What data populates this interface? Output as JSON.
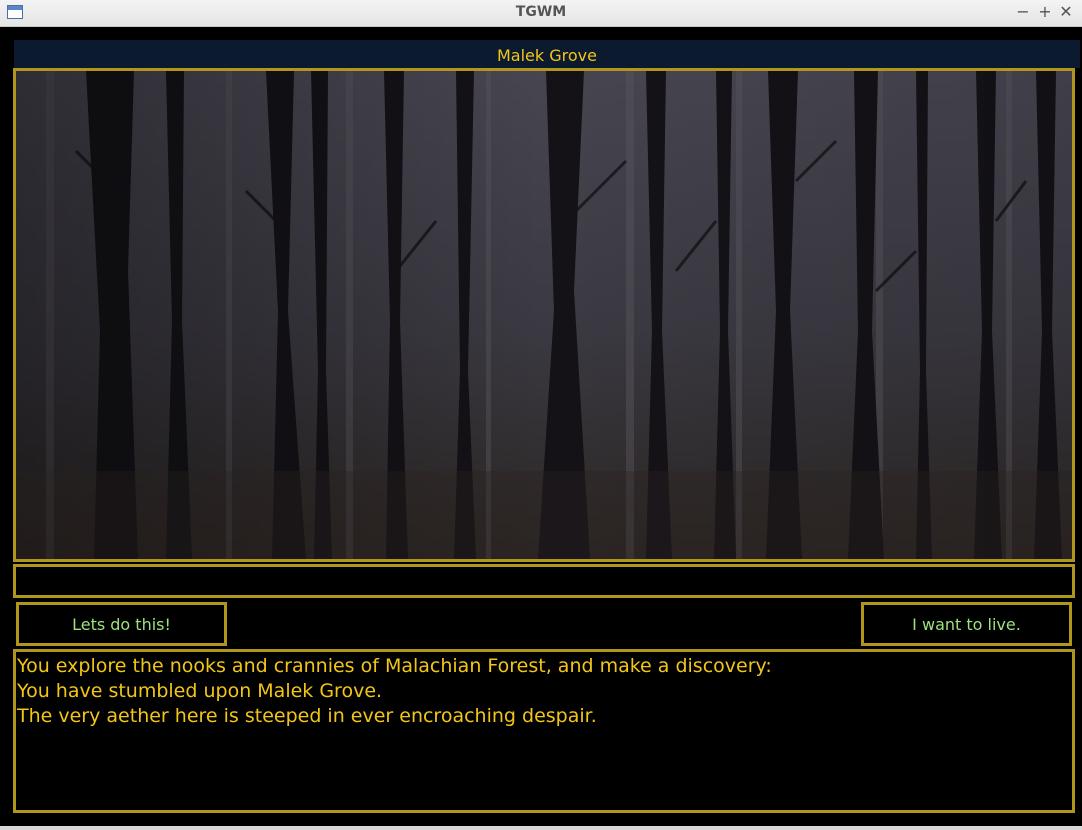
{
  "window": {
    "title": "TGWM",
    "controls": {
      "minimize": "−",
      "maximize": "+",
      "close": "✕"
    }
  },
  "location": {
    "title": "Malek Grove"
  },
  "scene": {
    "image_icon": "forest-scene-image",
    "colors": {
      "sky": "#3a383e",
      "trunk": "#0f0e11",
      "ground": "#2a2320"
    }
  },
  "choices": {
    "left_label": "Lets do this!",
    "right_label": "I want to live."
  },
  "log": {
    "lines": [
      "You explore the nooks and crannies of Malachian Forest, and make a discovery:",
      "You have stumbled upon Malek Grove.",
      "The very aether here is steeped in ever encroaching despair."
    ]
  },
  "theme": {
    "accent": "#f2c618",
    "border": "#b0961c",
    "button_text": "#9ee37b",
    "header_bg": "#0b1a2f"
  }
}
